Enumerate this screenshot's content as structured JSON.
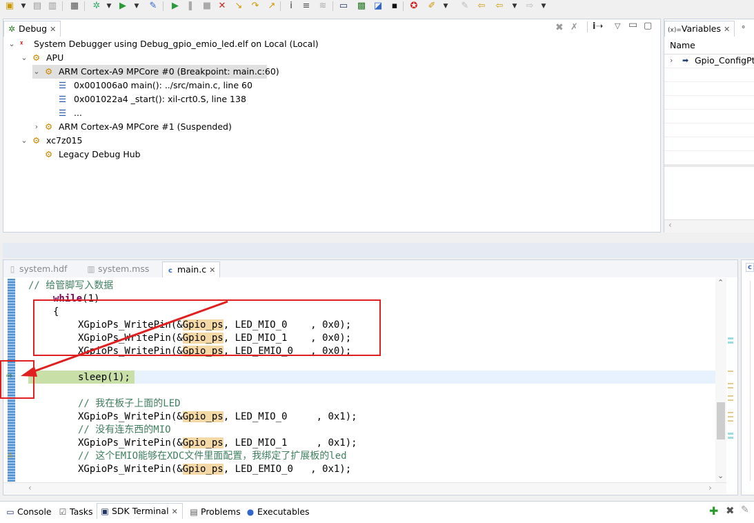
{
  "debug_panel": {
    "tab_label": "Debug",
    "tree": [
      {
        "label": "System Debugger using Debug_gpio_emio_led.elf on Local (Local)"
      },
      {
        "label": "APU"
      },
      {
        "label": "ARM Cortex-A9 MPCore #0 (Breakpoint: main.c:60)"
      },
      {
        "label": "0x001006a0 main(): ../src/main.c, line 60"
      },
      {
        "label": "0x001022a4 _start(): xil-crt0.S, line 138"
      },
      {
        "label": "..."
      },
      {
        "label": "ARM Cortex-A9 MPCore #1 (Suspended)"
      },
      {
        "label": "xc7z015"
      },
      {
        "label": "Legacy Debug Hub"
      }
    ]
  },
  "variables_panel": {
    "tab_label": "Variables",
    "tab_prefix": "(x)=",
    "column_header": "Name",
    "rows": [
      "Gpio_ConfigPtr"
    ]
  },
  "editor": {
    "tabs": [
      {
        "label": "system.hdf",
        "active": false
      },
      {
        "label": "system.mss",
        "active": false
      },
      {
        "label": "main.c",
        "active": true
      }
    ],
    "lines": {
      "l1": "// 给管脚写入数据",
      "l2_kw": "while",
      "l2_rest": "(1)",
      "l3": "{",
      "fn": "XGpioPs_WritePin(&",
      "var": "Gpio_ps",
      "l4_args": ", LED_MIO_0    , 0x0);",
      "l5_args": ", LED_MIO_1    , 0x0);",
      "l6_args": ", LED_EMIO_0   , 0x0);",
      "l8": "sleep(1);",
      "l10": "// 我在板子上面的LED",
      "l11_args": ", LED_MIO_0     , 0x1);",
      "l12": "// 没有连东西的MIO",
      "l13_args": ", LED_MIO_1     , 0x1);",
      "l14": "// 这个EMIO能够在XDC文件里面配置，我绑定了扩展板的led",
      "l15_args": ", LED_EMIO_0   , 0x1);"
    }
  },
  "bottom_tabs": [
    "Console",
    "Tasks",
    "SDK Terminal",
    "Problems",
    "Executables"
  ],
  "colors": {
    "panel_border": "#c7d2de",
    "current_line": "#c8e0a8",
    "annotation_red": "#e02020",
    "keyword": "#7f0055",
    "comment": "#3f7f5f",
    "occurrence": "#f4d9a6"
  }
}
